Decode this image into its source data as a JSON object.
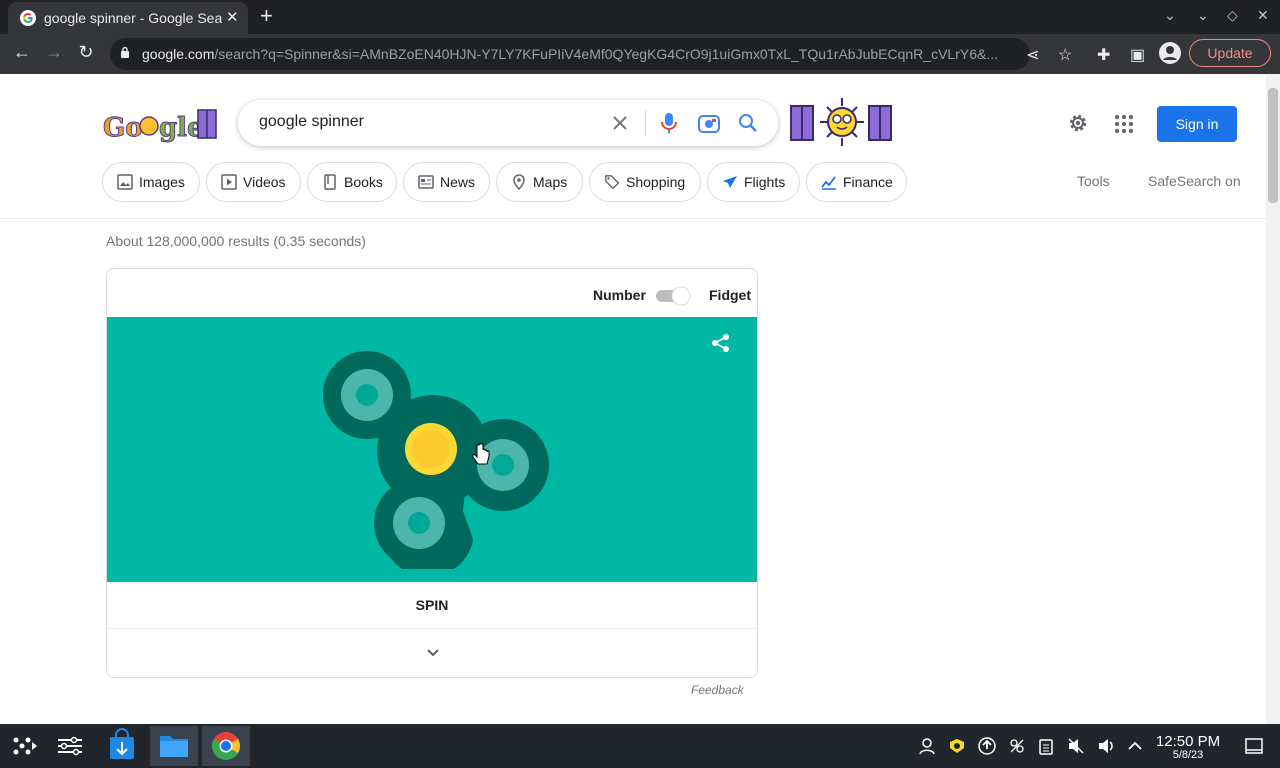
{
  "browser": {
    "tab_title": "google spinner - Google Search",
    "url_host": "google.com",
    "url_rest": "/search?q=Spinner&si=AMnBZoEN40HJN-Y7LY7KFuPIiV4eMf0QYegKG4CrO9j1uiGmx0TxL_TQu1rAbJubECqnR_cVLrY6&...",
    "update_label": "Update"
  },
  "search": {
    "query": "google spinner",
    "logo_text": "Google"
  },
  "header": {
    "signin_label": "Sign in"
  },
  "chips": [
    {
      "label": "Images",
      "icon": "image-icon"
    },
    {
      "label": "Videos",
      "icon": "play-icon"
    },
    {
      "label": "Books",
      "icon": "book-icon"
    },
    {
      "label": "News",
      "icon": "newspaper-icon"
    },
    {
      "label": "Maps",
      "icon": "map-pin-icon"
    },
    {
      "label": "Shopping",
      "icon": "tag-icon"
    },
    {
      "label": "Flights",
      "icon": "plane-icon"
    },
    {
      "label": "Finance",
      "icon": "chart-icon"
    }
  ],
  "tools_label": "Tools",
  "safesearch_label": "SafeSearch on",
  "result_stats": "About 128,000,000 results (0.35 seconds)",
  "widget": {
    "mode_left": "Number",
    "mode_right": "Fidget",
    "spin_label": "SPIN",
    "feedback_label": "Feedback",
    "colors": {
      "background": "#00b8a4",
      "spinner_body": "#00695c",
      "center": "#fdd835"
    }
  },
  "taskbar": {
    "time": "12:50 PM",
    "date": "5/8/23"
  }
}
